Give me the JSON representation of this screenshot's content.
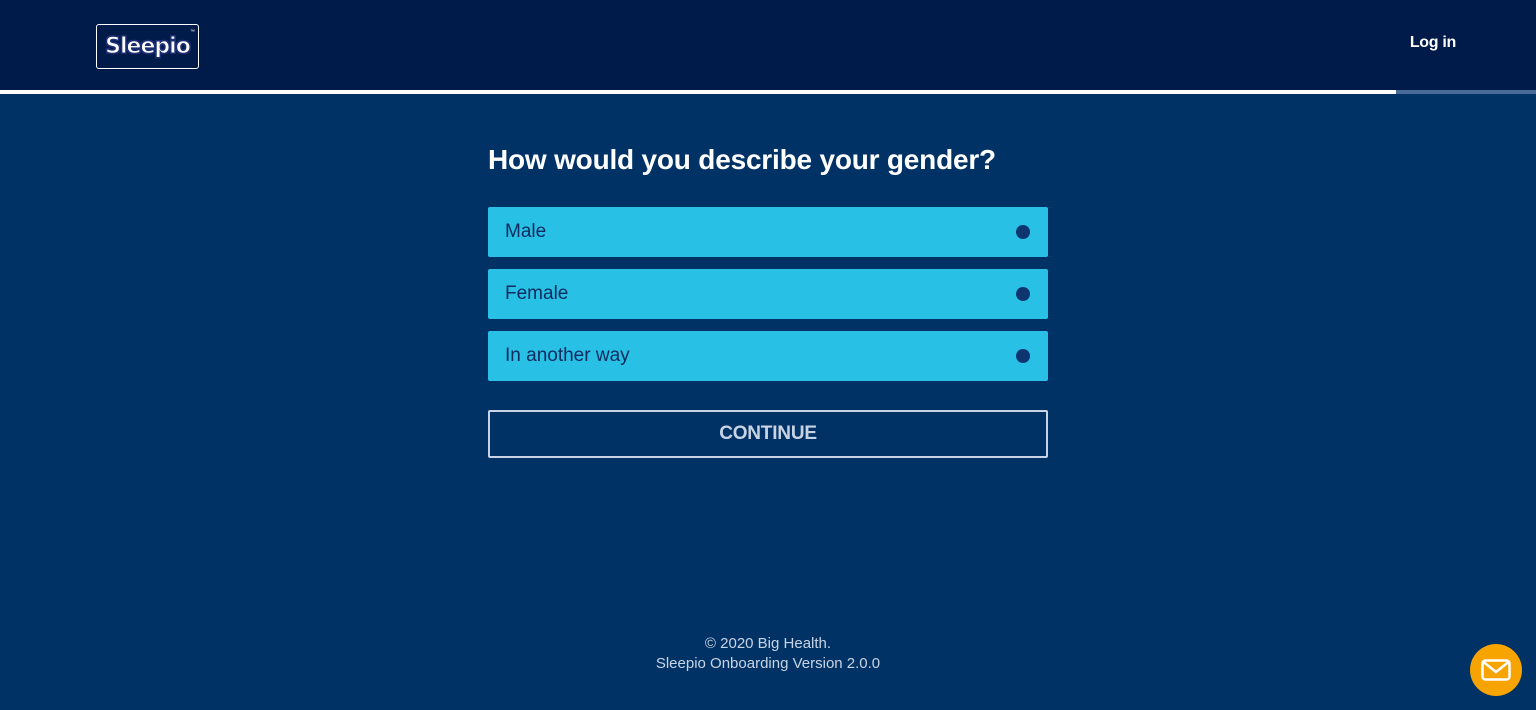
{
  "header": {
    "logo_text": "Sleepio",
    "logo_tm": "™",
    "login_label": "Log in"
  },
  "progress": {
    "fraction": 0.909
  },
  "question": {
    "title": "How would you describe your gender?",
    "options": [
      {
        "label": "Male"
      },
      {
        "label": "Female"
      },
      {
        "label": "In another way"
      }
    ]
  },
  "actions": {
    "continue_label": "CONTINUE"
  },
  "footer": {
    "copyright": "© 2020 Big Health.",
    "version": "Sleepio Onboarding Version 2.0.0"
  },
  "chat": {
    "icon": "envelope-icon"
  },
  "colors": {
    "header_bg": "#001a4a",
    "page_bg": "#003266",
    "option_bg": "#29c0e5",
    "chat_bg": "#f7a300"
  }
}
